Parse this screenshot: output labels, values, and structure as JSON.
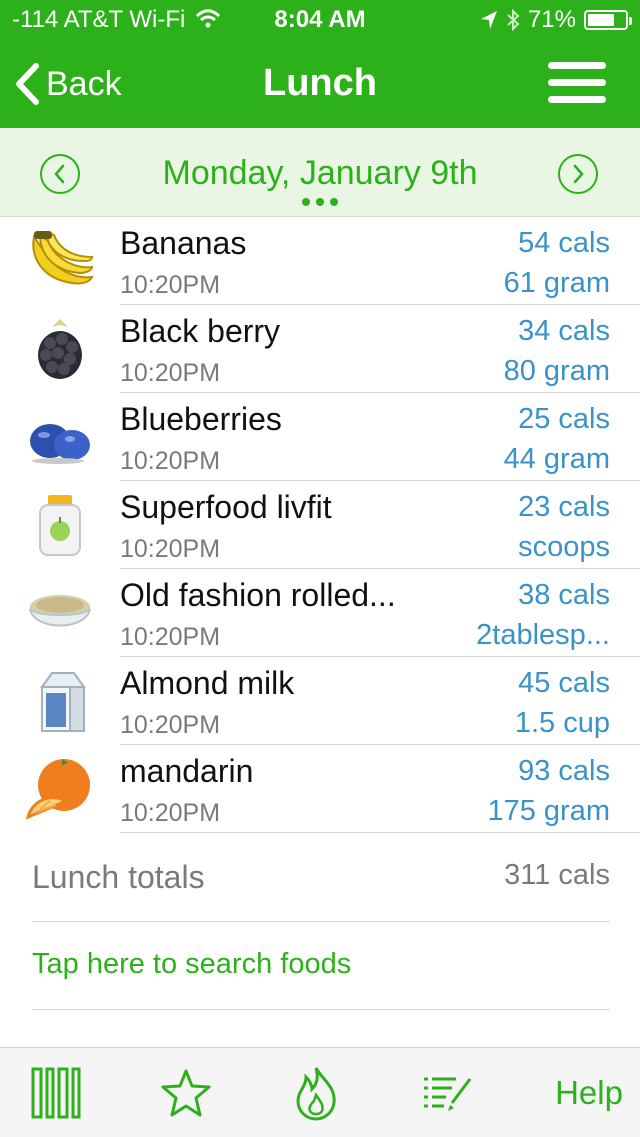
{
  "status_bar": {
    "carrier": "-114 AT&T Wi-Fi",
    "time": "8:04 AM",
    "battery": "71%",
    "battery_level": 0.71
  },
  "nav": {
    "back_label": "Back",
    "title": "Lunch"
  },
  "date": {
    "label": "Monday, January 9th"
  },
  "foods": [
    {
      "name": "Bananas",
      "time": "10:20PM",
      "cals": "54 cals",
      "qty": "61 gram",
      "icon": "banana-icon"
    },
    {
      "name": "Black berry",
      "time": "10:20PM",
      "cals": "34 cals",
      "qty": "80 gram",
      "icon": "blackberry-icon"
    },
    {
      "name": "Blueberries",
      "time": "10:20PM",
      "cals": "25 cals",
      "qty": "44 gram",
      "icon": "blueberries-icon"
    },
    {
      "name": "Superfood livfit",
      "time": "10:20PM",
      "cals": "23 cals",
      "qty": "scoops",
      "icon": "supplement-jar-icon"
    },
    {
      "name": "Old fashion rolled...",
      "time": "10:20PM",
      "cals": "38 cals",
      "qty": "2tablesp...",
      "icon": "oatmeal-bowl-icon"
    },
    {
      "name": "Almond milk",
      "time": "10:20PM",
      "cals": "45 cals",
      "qty": "1.5 cup",
      "icon": "milk-carton-icon"
    },
    {
      "name": "mandarin",
      "time": "10:20PM",
      "cals": "93 cals",
      "qty": "175 gram",
      "icon": "orange-icon"
    }
  ],
  "totals": {
    "label": "Lunch totals",
    "value": "311 cals"
  },
  "search": {
    "label": "Tap here to search foods"
  },
  "tabbar": {
    "help_label": "Help",
    "icons": [
      "barcode-icon",
      "star-icon",
      "flame-icon",
      "checklist-edit-icon"
    ]
  },
  "colors": {
    "brand_green": "#2db11b",
    "date_bar_bg": "#e9f6e3",
    "value_blue": "#3a93c8",
    "muted_gray": "#7a7a7a"
  }
}
